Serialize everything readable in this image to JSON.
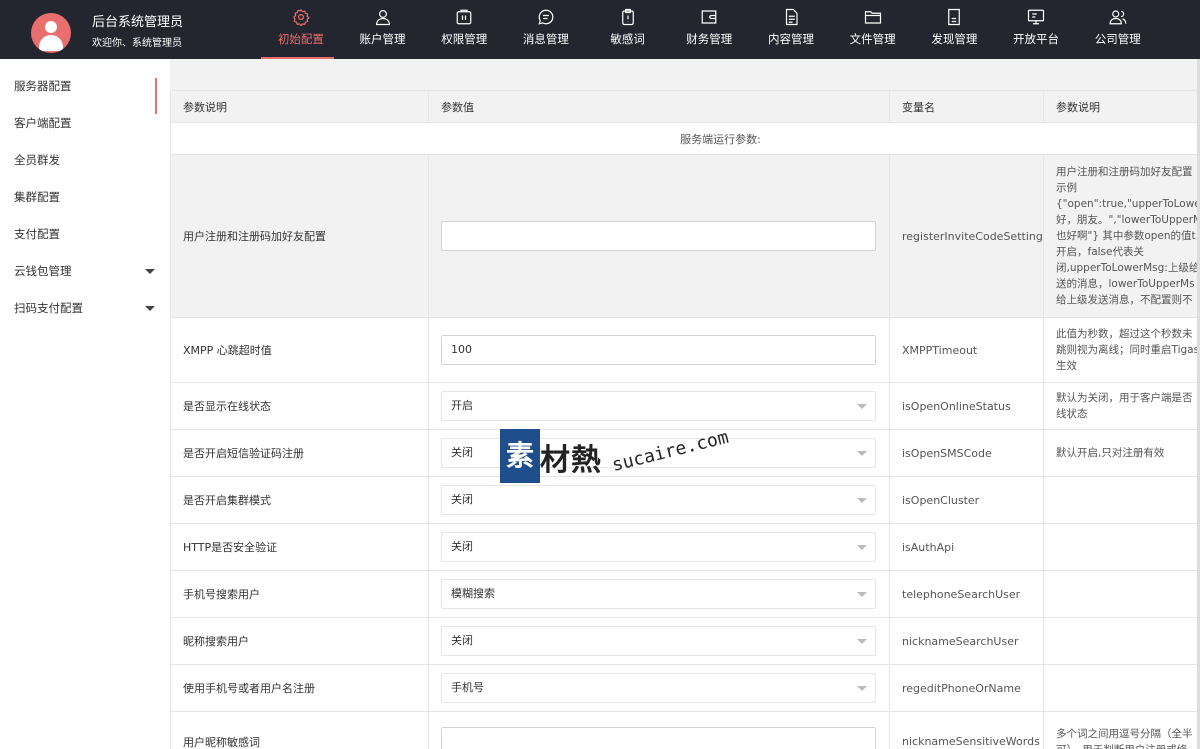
{
  "header": {
    "title": "后台系统管理员",
    "subtitle": "欢迎你、系统管理员",
    "nav": [
      {
        "label": "初始配置",
        "icon": "gear-icon",
        "active": true
      },
      {
        "label": "账户管理",
        "icon": "user-icon"
      },
      {
        "label": "权限管理",
        "icon": "key-lock-icon"
      },
      {
        "label": "消息管理",
        "icon": "message-icon"
      },
      {
        "label": "敏感词",
        "icon": "alert-clipboard-icon"
      },
      {
        "label": "财务管理",
        "icon": "wallet-icon"
      },
      {
        "label": "内容管理",
        "icon": "document-icon"
      },
      {
        "label": "文件管理",
        "icon": "folder-icon"
      },
      {
        "label": "发现管理",
        "icon": "file-icon"
      },
      {
        "label": "开放平台",
        "icon": "monitor-icon"
      },
      {
        "label": "公司管理",
        "icon": "users-icon"
      }
    ]
  },
  "sidebar": {
    "items": [
      {
        "label": "服务器配置",
        "active": true
      },
      {
        "label": "客户端配置"
      },
      {
        "label": "全员群发"
      },
      {
        "label": "集群配置"
      },
      {
        "label": "支付配置"
      },
      {
        "label": "云钱包管理",
        "caret": true
      },
      {
        "label": "扫码支付配置",
        "caret": true
      }
    ]
  },
  "table": {
    "headers": [
      "参数说明",
      "参数值",
      "变量名",
      "参数说明"
    ],
    "section_title": "服务端运行参数:",
    "rows": [
      {
        "desc": "用户注册和注册码加好友配置",
        "control": "input",
        "value": "",
        "var": "registerInviteCodeSetting",
        "note_lines": [
          "用户注册和注册码加好友配置",
          "示例",
          "{\"open\":true,\"upperToLowerM",
          "好，朋友。\",\"lowerToUpperM",
          "也好啊\"} 其中参数open的值t",
          "开启，false代表关",
          "闭,upperToLowerMsg:上级给",
          "送的消息，lowerToUpperMs",
          "给上级发送消息，不配置则不"
        ]
      },
      {
        "desc": "XMPP 心跳超时值",
        "control": "input",
        "value": "100",
        "var": "XMPPTimeout",
        "note_lines": [
          "此值为秒数，超过这个秒数未",
          "跳则视为离线；同时重启Tigas",
          "生效"
        ]
      },
      {
        "desc": "是否显示在线状态",
        "control": "select",
        "value": "开启",
        "var": "isOpenOnlineStatus",
        "note_lines": [
          "默认为关闭，用于客户端是否",
          "线状态"
        ]
      },
      {
        "desc": "是否开启短信验证码注册",
        "control": "select",
        "value": "关闭",
        "var": "isOpenSMSCode",
        "note_lines": [
          "默认开启,只对注册有效"
        ]
      },
      {
        "desc": "是否开启集群模式",
        "control": "select",
        "value": "关闭",
        "var": "isOpenCluster",
        "note_lines": []
      },
      {
        "desc": "HTTP是否安全验证",
        "control": "select",
        "value": "关闭",
        "var": "isAuthApi",
        "note_lines": []
      },
      {
        "desc": "手机号搜索用户",
        "control": "select",
        "value": "模糊搜索",
        "var": "telephoneSearchUser",
        "note_lines": []
      },
      {
        "desc": "昵称搜索用户",
        "control": "select",
        "value": "关闭",
        "var": "nicknameSearchUser",
        "note_lines": []
      },
      {
        "desc": "使用手机号或者用户名注册",
        "control": "select",
        "value": "手机号",
        "var": "regeditPhoneOrName",
        "note_lines": []
      },
      {
        "desc": "用户昵称敏感词",
        "control": "input",
        "value": "",
        "var": "nicknameSensitiveWords",
        "note_lines": [
          "多个词之间用逗号分隔（全半",
          "可）。用于判断用户注册或修"
        ]
      }
    ]
  },
  "watermark": {
    "mark": "素",
    "cn": "材熱",
    "en": "sucaire.com"
  }
}
